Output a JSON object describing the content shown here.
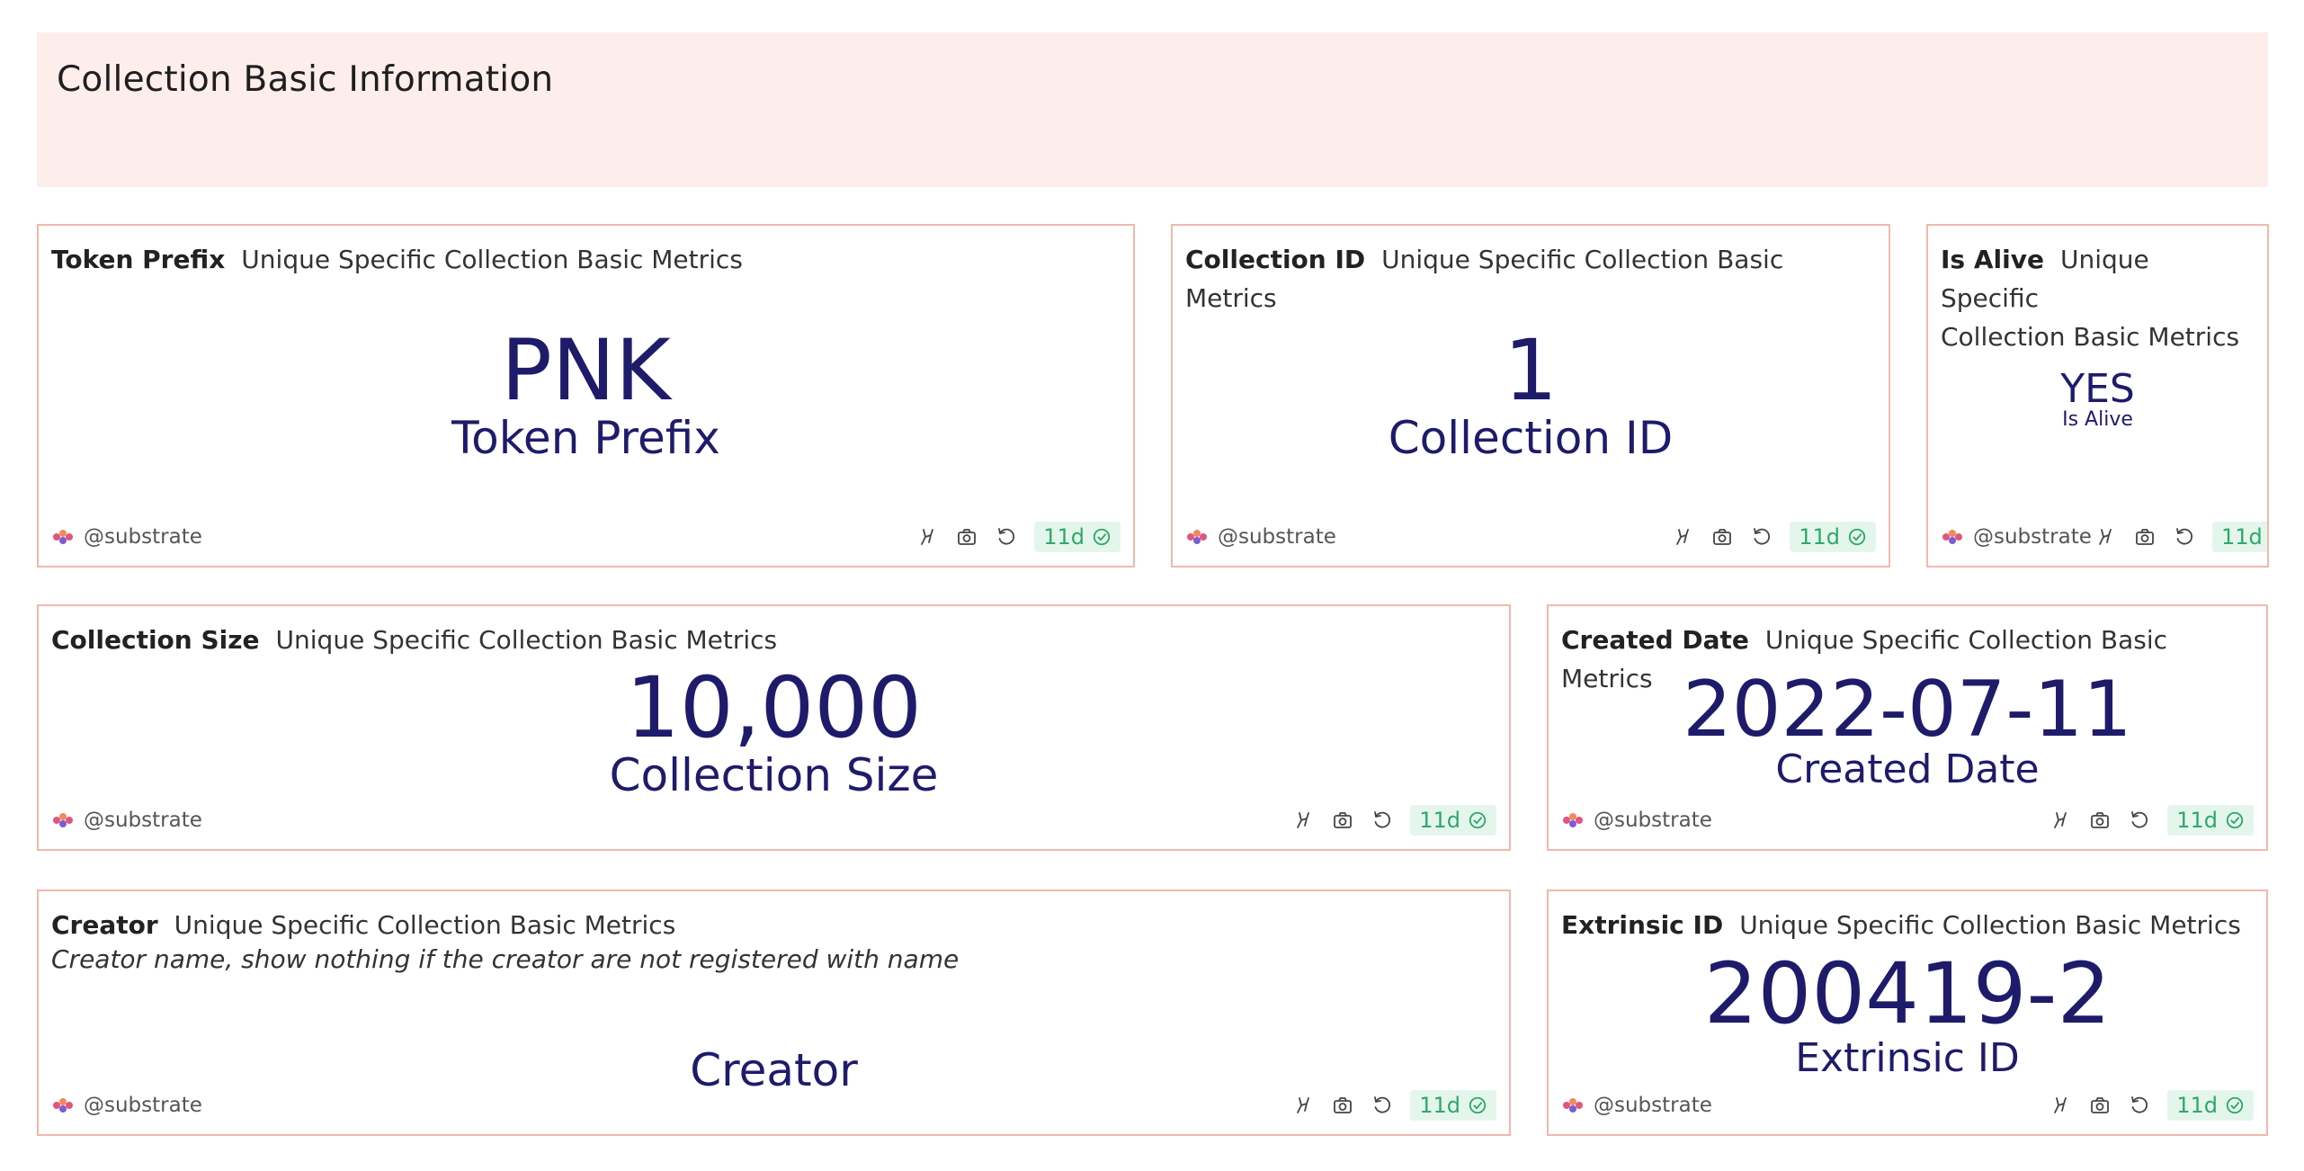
{
  "header": {
    "title": "Collection Basic Information"
  },
  "cards": [
    {
      "title": "Token Prefix",
      "subtitle": "Unique Specific Collection Basic Metrics",
      "value": "PNK",
      "label": "Token Prefix",
      "owner": "@substrate",
      "age": "11d"
    },
    {
      "title": "Collection ID",
      "subtitle": "Unique Specific Collection Basic Metrics",
      "value": "1",
      "label": "Collection ID",
      "owner": "@substrate",
      "age": "11d"
    },
    {
      "title": "Is Alive",
      "subtitle": "Unique Specific",
      "subtitle2": "Collection Basic Metrics",
      "value": "YES",
      "label": "Is Alive",
      "owner": "@substrate",
      "age": "11d"
    },
    {
      "title": "Collection Size",
      "subtitle": "Unique Specific Collection Basic Metrics",
      "value": "10,000",
      "label": "Collection Size",
      "owner": "@substrate",
      "age": "11d"
    },
    {
      "title": "Created Date",
      "subtitle": "Unique Specific Collection Basic Metrics",
      "value": "2022-07-11",
      "label": "Created Date",
      "owner": "@substrate",
      "age": "11d"
    },
    {
      "title": "Creator",
      "subtitle": "Unique Specific Collection Basic Metrics",
      "description": "Creator name, show nothing if the creator are not registered with name",
      "value": "",
      "label": "Creator",
      "owner": "@substrate",
      "age": "11d"
    },
    {
      "title": "Extrinsic ID",
      "subtitle": "Unique Specific Collection Basic Metrics",
      "value": "200419-2",
      "label": "Extrinsic ID",
      "owner": "@substrate",
      "age": "11d"
    }
  ],
  "icons": {
    "owner_logo": "substrate-logo-icon",
    "actions": [
      "fork-icon",
      "camera-icon",
      "refresh-icon",
      "check-circle-icon"
    ]
  },
  "colors": {
    "header_bg": "#fdeeec",
    "card_border": "#f0b9ac",
    "value_text": "#1f1b6b",
    "badge_bg": "#e4f6ec",
    "badge_text": "#2ea86a"
  }
}
